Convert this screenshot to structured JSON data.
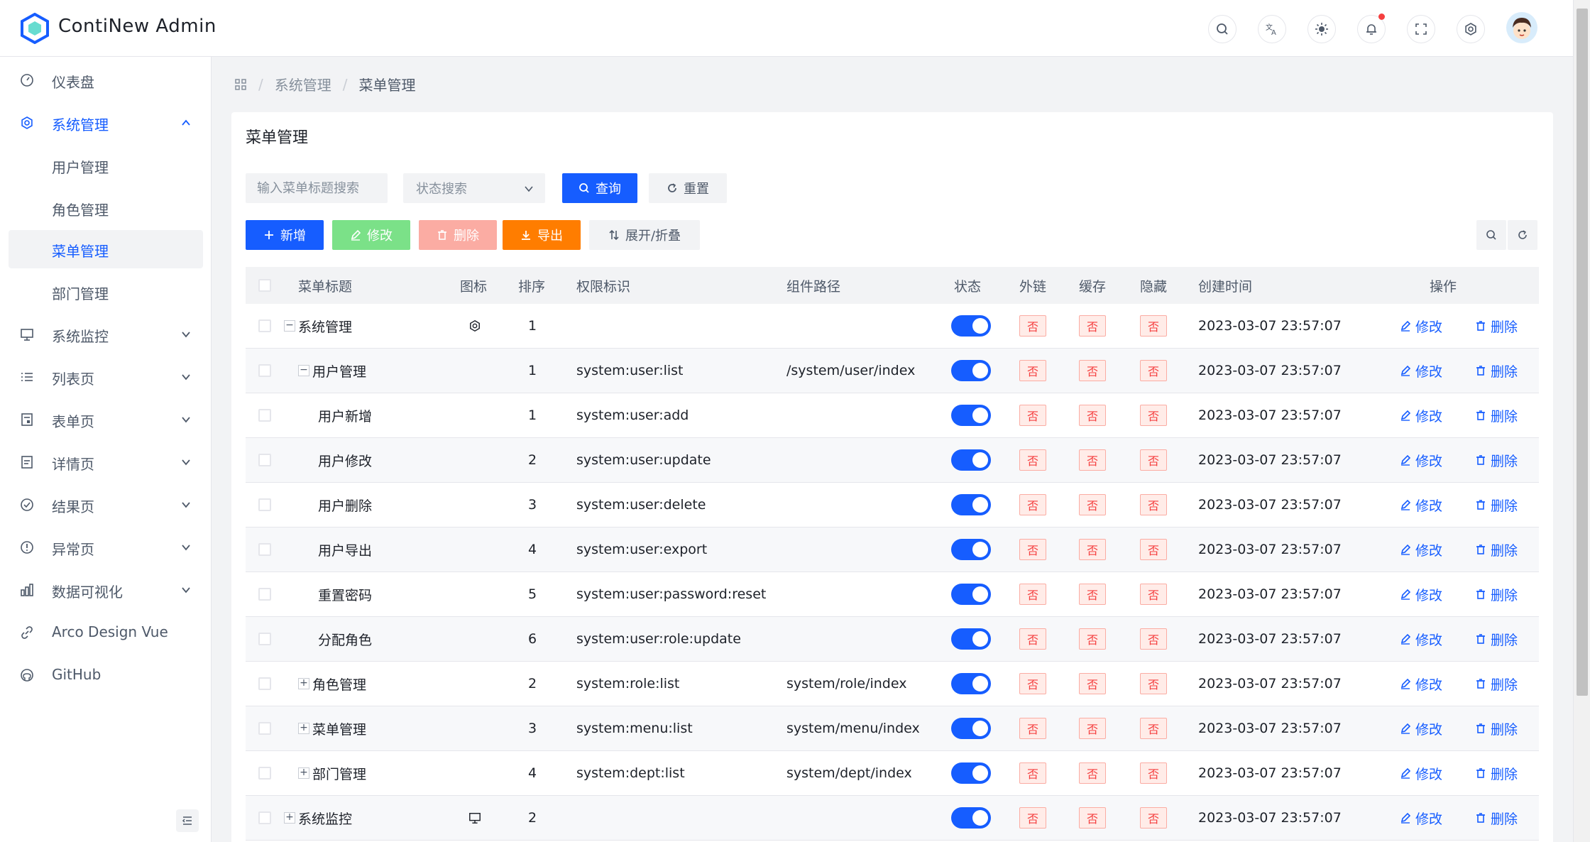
{
  "app": {
    "title": "ContiNew Admin"
  },
  "header": {
    "icons": [
      "search-icon",
      "translate-icon",
      "theme-icon",
      "bell-icon",
      "fullscreen-icon",
      "gear-icon"
    ]
  },
  "sidebar": {
    "items": [
      {
        "label": "仪表盘",
        "icon": "dashboard-icon"
      },
      {
        "label": "系统管理",
        "icon": "gear-icon",
        "expanded": true
      },
      {
        "label": "用户管理"
      },
      {
        "label": "角色管理"
      },
      {
        "label": "菜单管理",
        "selected": true
      },
      {
        "label": "部门管理"
      },
      {
        "label": "系统监控",
        "icon": "monitor-icon"
      },
      {
        "label": "列表页",
        "icon": "list-icon"
      },
      {
        "label": "表单页",
        "icon": "form-icon"
      },
      {
        "label": "详情页",
        "icon": "file-icon"
      },
      {
        "label": "结果页",
        "icon": "check-circle-icon"
      },
      {
        "label": "异常页",
        "icon": "exclamation-icon"
      },
      {
        "label": "数据可视化",
        "icon": "chart-icon"
      },
      {
        "label": "Arco Design Vue",
        "icon": "link-icon"
      },
      {
        "label": "GitHub",
        "icon": "github-icon"
      }
    ]
  },
  "breadcrumb": {
    "items": [
      "系统管理",
      "菜单管理"
    ]
  },
  "panel": {
    "title": "菜单管理",
    "search_placeholder": "输入菜单标题搜索",
    "status_placeholder": "状态搜索",
    "query_label": "查询",
    "reset_label": "重置",
    "add_label": "新增",
    "edit_label": "修改",
    "delete_label": "删除",
    "export_label": "导出",
    "expand_label": "展开/折叠"
  },
  "table": {
    "columns": [
      "菜单标题",
      "图标",
      "排序",
      "权限标识",
      "组件路径",
      "状态",
      "外链",
      "缓存",
      "隐藏",
      "创建时间",
      "操作"
    ],
    "tag_no": "否",
    "edit_action": "修改",
    "delete_action": "删除",
    "rows": [
      {
        "title": "系统管理",
        "level": 0,
        "expand": "−",
        "icon": "gear",
        "sort": "1",
        "perm": "",
        "path": "",
        "time": "2023-03-07 23:57:07"
      },
      {
        "title": "用户管理",
        "level": 1,
        "expand": "−",
        "icon": "",
        "sort": "1",
        "perm": "system:user:list",
        "path": "/system/user/index",
        "time": "2023-03-07 23:57:07"
      },
      {
        "title": "用户新增",
        "level": 2,
        "expand": "",
        "icon": "",
        "sort": "1",
        "perm": "system:user:add",
        "path": "",
        "time": "2023-03-07 23:57:07"
      },
      {
        "title": "用户修改",
        "level": 2,
        "expand": "",
        "icon": "",
        "sort": "2",
        "perm": "system:user:update",
        "path": "",
        "time": "2023-03-07 23:57:07"
      },
      {
        "title": "用户删除",
        "level": 2,
        "expand": "",
        "icon": "",
        "sort": "3",
        "perm": "system:user:delete",
        "path": "",
        "time": "2023-03-07 23:57:07"
      },
      {
        "title": "用户导出",
        "level": 2,
        "expand": "",
        "icon": "",
        "sort": "4",
        "perm": "system:user:export",
        "path": "",
        "time": "2023-03-07 23:57:07"
      },
      {
        "title": "重置密码",
        "level": 2,
        "expand": "",
        "icon": "",
        "sort": "5",
        "perm": "system:user:password:reset",
        "path": "",
        "time": "2023-03-07 23:57:07"
      },
      {
        "title": "分配角色",
        "level": 2,
        "expand": "",
        "icon": "",
        "sort": "6",
        "perm": "system:user:role:update",
        "path": "",
        "time": "2023-03-07 23:57:07"
      },
      {
        "title": "角色管理",
        "level": 1,
        "expand": "+",
        "icon": "",
        "sort": "2",
        "perm": "system:role:list",
        "path": "system/role/index",
        "time": "2023-03-07 23:57:07"
      },
      {
        "title": "菜单管理",
        "level": 1,
        "expand": "+",
        "icon": "",
        "sort": "3",
        "perm": "system:menu:list",
        "path": "system/menu/index",
        "time": "2023-03-07 23:57:07"
      },
      {
        "title": "部门管理",
        "level": 1,
        "expand": "+",
        "icon": "",
        "sort": "4",
        "perm": "system:dept:list",
        "path": "system/dept/index",
        "time": "2023-03-07 23:57:07"
      },
      {
        "title": "系统监控",
        "level": 0,
        "expand": "+",
        "icon": "monitor",
        "sort": "2",
        "perm": "",
        "path": "",
        "time": "2023-03-07 23:57:07"
      }
    ]
  }
}
